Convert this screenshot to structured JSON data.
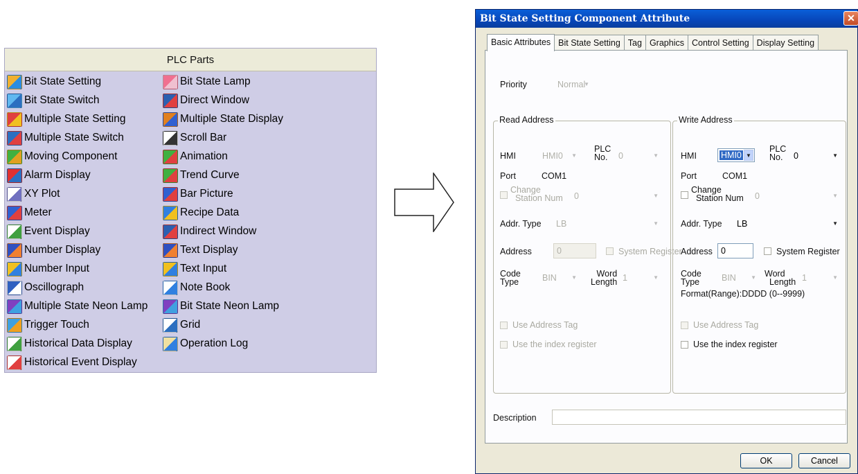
{
  "plc_parts": {
    "title": "PLC Parts",
    "left_items": [
      {
        "label": "Bit State Setting",
        "icon": "bit-state-setting-icon"
      },
      {
        "label": "Bit State Switch",
        "icon": "bit-state-switch-icon"
      },
      {
        "label": "Multiple State Setting",
        "icon": "multiple-state-setting-icon"
      },
      {
        "label": "Multiple State Switch",
        "icon": "multiple-state-switch-icon"
      },
      {
        "label": "Moving Component",
        "icon": "moving-component-icon"
      },
      {
        "label": "Alarm Display",
        "icon": "alarm-display-icon"
      },
      {
        "label": "XY Plot",
        "icon": "xy-plot-icon"
      },
      {
        "label": "Meter",
        "icon": "meter-icon"
      },
      {
        "label": "Event Display",
        "icon": "event-display-icon"
      },
      {
        "label": "Number Display",
        "icon": "number-display-icon"
      },
      {
        "label": "Number Input",
        "icon": "number-input-icon"
      },
      {
        "label": "Oscillograph",
        "icon": "oscillograph-icon"
      },
      {
        "label": "Multiple State Neon Lamp",
        "icon": "multiple-state-neon-lamp-icon"
      },
      {
        "label": "Trigger Touch",
        "icon": "trigger-touch-icon"
      },
      {
        "label": "Historical Data Display",
        "icon": "historical-data-display-icon"
      },
      {
        "label": "Historical Event Display",
        "icon": "historical-event-display-icon"
      }
    ],
    "right_items": [
      {
        "label": "Bit State Lamp",
        "icon": "bit-state-lamp-icon"
      },
      {
        "label": "Direct Window",
        "icon": "direct-window-icon"
      },
      {
        "label": "Multiple State Display",
        "icon": "multiple-state-display-icon"
      },
      {
        "label": "Scroll Bar",
        "icon": "scroll-bar-icon"
      },
      {
        "label": "Animation",
        "icon": "animation-icon"
      },
      {
        "label": "Trend Curve",
        "icon": "trend-curve-icon"
      },
      {
        "label": "Bar Picture",
        "icon": "bar-picture-icon"
      },
      {
        "label": "Recipe Data",
        "icon": "recipe-data-icon"
      },
      {
        "label": "Indirect Window",
        "icon": "indirect-window-icon"
      },
      {
        "label": "Text Display",
        "icon": "text-display-icon"
      },
      {
        "label": "Text Input",
        "icon": "text-input-icon"
      },
      {
        "label": "Note Book",
        "icon": "note-book-icon"
      },
      {
        "label": "Bit State Neon Lamp",
        "icon": "bit-state-neon-lamp-icon"
      },
      {
        "label": "Grid",
        "icon": "grid-icon"
      },
      {
        "label": "Operation Log",
        "icon": "operation-log-icon"
      }
    ]
  },
  "dialog": {
    "title": "Bit State Setting Component Attribute",
    "close_glyph": "✕",
    "tabs": [
      "Basic Attributes",
      "Bit State Setting",
      "Tag",
      "Graphics",
      "Control Setting",
      "Display Setting"
    ],
    "priority": {
      "label": "Priority",
      "value": "Normal"
    },
    "read": {
      "group": "Read Address",
      "hmi_label": "HMI",
      "hmi_value": "HMI0",
      "plc_label": "PLC",
      "no_label": "No.",
      "plc_value": "0",
      "port_label": "Port",
      "port_value": "COM1",
      "change_label_1": "Change",
      "change_label_2": "Station Num",
      "change_value": "0",
      "addr_type_label": "Addr. Type",
      "addr_type_value": "LB",
      "address_label": "Address",
      "address_value": "0",
      "sysreg_label": "System Register",
      "code_label_1": "Code",
      "code_label_2": "Type",
      "code_value": "BIN",
      "word_label_1": "Word",
      "word_label_2": "Length",
      "word_value": "1",
      "use_tag": "Use Address Tag",
      "use_index": "Use the index register"
    },
    "write": {
      "group": "Write Address",
      "hmi_label": "HMI",
      "hmi_value": "HMI0",
      "plc_label": "PLC",
      "no_label": "No.",
      "plc_value": "0",
      "port_label": "Port",
      "port_value": "COM1",
      "change_label_1": "Change",
      "change_label_2": "Station Num",
      "change_value": "0",
      "addr_type_label": "Addr. Type",
      "addr_type_value": "LB",
      "address_label": "Address",
      "address_value": "0",
      "sysreg_label": "System Register",
      "code_label_1": "Code",
      "code_label_2": "Type",
      "code_value": "BIN",
      "word_label_1": "Word",
      "word_label_2": "Length",
      "word_value": "1",
      "format": "Format(Range):DDDD (0--9999)",
      "use_tag": "Use Address Tag",
      "use_index": "Use the index register"
    },
    "description_label": "Description",
    "description_value": "",
    "ok_label": "OK",
    "cancel_label": "Cancel"
  }
}
